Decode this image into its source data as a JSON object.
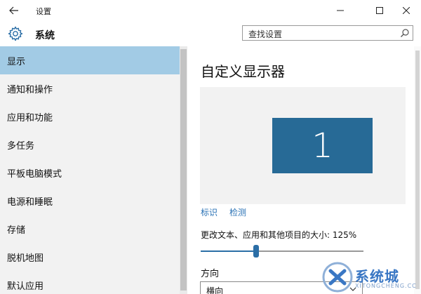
{
  "window": {
    "title": "设置",
    "back_icon": "arrow-left-icon",
    "minimize_icon": "minimize-icon",
    "maximize_icon": "maximize-icon",
    "close_icon": "close-icon"
  },
  "header": {
    "icon": "gear-icon",
    "title": "系统",
    "search_placeholder": "查找设置",
    "search_icon": "search-icon"
  },
  "sidebar": {
    "items": [
      {
        "label": "显示",
        "active": true
      },
      {
        "label": "通知和操作",
        "active": false
      },
      {
        "label": "应用和功能",
        "active": false
      },
      {
        "label": "多任务",
        "active": false
      },
      {
        "label": "平板电脑模式",
        "active": false
      },
      {
        "label": "电源和睡眠",
        "active": false
      },
      {
        "label": "存储",
        "active": false
      },
      {
        "label": "脱机地图",
        "active": false
      },
      {
        "label": "默认应用",
        "active": false
      }
    ]
  },
  "main": {
    "title": "自定义显示器",
    "monitor_number": "1",
    "links": {
      "identify": "标识",
      "detect": "检测"
    },
    "scale_label": "更改文本、应用和其他项目的大小: 125%",
    "scale_slider_fraction": 0.34,
    "orientation_label": "方向",
    "orientation_value": "横向"
  },
  "watermark": {
    "text": "系统城",
    "sub": "XITONGCHENG.CC"
  },
  "colors": {
    "accent": "#2b6ea6",
    "sidebar_active": "#a2cbe5",
    "monitor": "#276a96",
    "link": "#2a72b5"
  }
}
